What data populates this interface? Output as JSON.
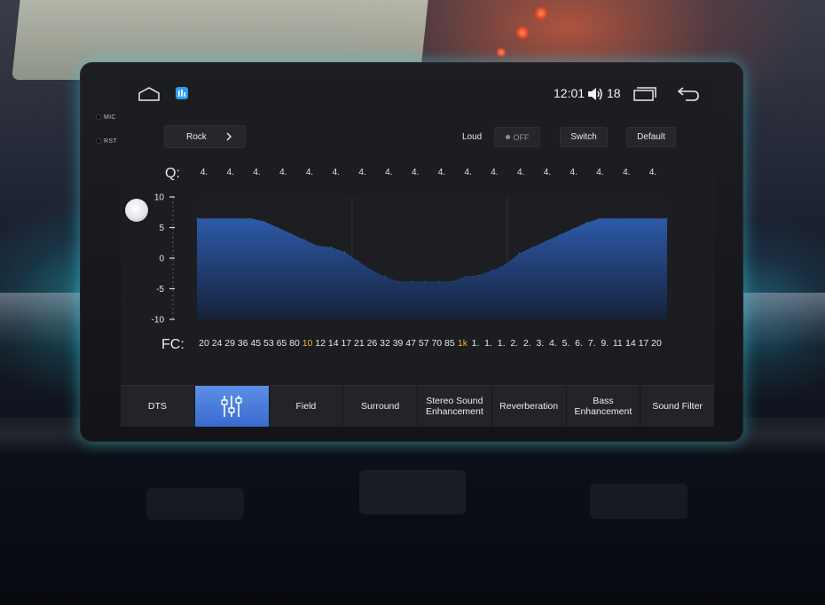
{
  "device": {
    "side_labels": [
      "MIC",
      "RST"
    ]
  },
  "statusbar": {
    "time": "12:01",
    "volume_level": "18"
  },
  "controls": {
    "preset": "Rock",
    "loud_label": "Loud",
    "loud_state": "OFF",
    "switch_label": "Switch",
    "default_label": "Default"
  },
  "q_row": {
    "label": "Q:",
    "values": [
      "4.",
      "4.",
      "4.",
      "4.",
      "4.",
      "4.",
      "4.",
      "4.",
      "4.",
      "4.",
      "4.",
      "4.",
      "4.",
      "4.",
      "4.",
      "4.",
      "4.",
      "4."
    ]
  },
  "fc_row": {
    "label": "FC:",
    "values": [
      "20",
      "24",
      "29",
      "36",
      "45",
      "53",
      "65",
      "80",
      "10",
      "12",
      "14",
      "17",
      "21",
      "26",
      "32",
      "39",
      "47",
      "57",
      "70",
      "85",
      "1k",
      "1.",
      "1.",
      "1.",
      "2.",
      "2.",
      "3.",
      "4.",
      "5.",
      "6.",
      "7.",
      "9.",
      "11",
      "14",
      "17",
      "20"
    ],
    "highlighted_indices": [
      8,
      20
    ],
    "highlight_color": "#f2b53a"
  },
  "chart_data": {
    "type": "area",
    "ylim": [
      -10,
      10
    ],
    "yticks": [
      "10",
      "5",
      "0",
      "-5",
      "-10"
    ],
    "x": [
      "20",
      "24",
      "29",
      "36",
      "45",
      "53",
      "65",
      "80",
      "10",
      "12",
      "14",
      "17",
      "21",
      "26",
      "32",
      "39",
      "47",
      "57",
      "70",
      "85",
      "1k",
      "1.",
      "1.",
      "1.",
      "2.",
      "2.",
      "3.",
      "4.",
      "5.",
      "6.",
      "7.",
      "9.",
      "11",
      "14",
      "17",
      "20"
    ],
    "values": [
      6.5,
      6.5,
      6.5,
      6.5,
      6.5,
      6.0,
      5.0,
      4.0,
      3.0,
      2.0,
      1.8,
      1.0,
      -0.5,
      -2.0,
      -3.0,
      -3.8,
      -3.8,
      -3.8,
      -3.8,
      -3.8,
      -3.0,
      -2.8,
      -2.0,
      -1.0,
      0.8,
      1.8,
      2.8,
      3.8,
      4.8,
      5.8,
      6.5,
      6.5,
      6.5,
      6.5,
      6.5,
      6.5
    ],
    "fill_color": "#2d5aa8",
    "grid": true
  },
  "tabs": [
    {
      "label": "DTS"
    },
    {
      "label": "",
      "icon": "equalizer-icon",
      "active": true
    },
    {
      "label": "Field"
    },
    {
      "label": "Surround"
    },
    {
      "label": "Stereo Sound\nEnhancement"
    },
    {
      "label": "Reverberation"
    },
    {
      "label": "Bass\nEnhancement"
    },
    {
      "label": "Sound Filter"
    }
  ]
}
